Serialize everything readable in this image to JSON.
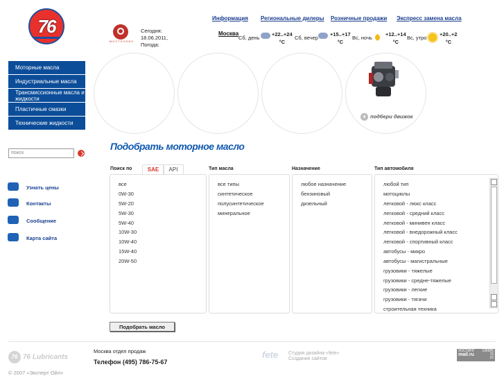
{
  "brand": {
    "logo_text": "76",
    "mos_text": "М О С Т Е Х Н И Ч"
  },
  "top_nav": [
    "Информация",
    "Региональные дилеры",
    "Розничные продажи",
    "Экспресс замена масла"
  ],
  "date": {
    "today_label": "Сегодня:",
    "date": "18.06.2011,",
    "weather_label": "Погода:"
  },
  "weather": {
    "city": "Москва",
    "slots": [
      {
        "label": "Сб, день",
        "temp": "+22..+24",
        "unit": "°C",
        "icon": "cloud-rain-icon"
      },
      {
        "label": "Сб, вечер",
        "temp": "+15..+17",
        "unit": "°C",
        "icon": "cloud-sun-icon"
      },
      {
        "label": "Вс, ночь",
        "temp": "+12..+14",
        "unit": "°C",
        "icon": "moon-icon"
      },
      {
        "label": "Вс, утро",
        "temp": "+20..+22",
        "unit": "°C",
        "icon": "sun-icon"
      }
    ]
  },
  "menu": [
    "Моторные масла",
    "Индустриальные масла",
    "Трансмиссионные масла и жидкости",
    "Пластичные смазки",
    "Технические жидкости"
  ],
  "search": {
    "placeholder": "поиск"
  },
  "side_links": [
    {
      "label": "Узнать цены",
      "icon": "chat-icon"
    },
    {
      "label": "Контакты",
      "icon": "phone-icon"
    },
    {
      "label": "Сообщение",
      "icon": "envelope-icon"
    },
    {
      "label": "Карта сайта",
      "icon": "sitemap-icon"
    }
  ],
  "promo": {
    "label": "подбери движок"
  },
  "selector": {
    "title": "Подобрать моторное масло",
    "search_by": "Поиск по",
    "tabs": [
      "SAE",
      "API"
    ],
    "active_tab": "SAE",
    "headers": [
      "Тип масла",
      "Назначение",
      "Тип автомобиля"
    ],
    "sae": [
      "все",
      "0W-30",
      "5W-20",
      "5W-30",
      "5W-40",
      "10W-30",
      "10W-40",
      "15W-40",
      "20W-50"
    ],
    "oil_types": [
      "все типы",
      "синтетическое",
      "полусинтетическое",
      "минеральное"
    ],
    "purpose": [
      "любое назначение",
      "бензиновый",
      "дизельный"
    ],
    "vehicle_types": [
      "любой тип",
      "мотоциклы",
      "легковой - люкс класс",
      "легковой - средний класс",
      "легковой - минивен класс",
      "легковой - внедорожный класс",
      "легковой - спортивный класс",
      "автобусы - микро",
      "автобусы - магистральные",
      "грузовики - тяжелые",
      "грузовики - средне-тяжелые",
      "грузовики - легкие",
      "грузовики - тягачи",
      "строительная техника"
    ],
    "submit": "Подобрать масло"
  },
  "footer": {
    "brand": "76 Lubricants",
    "copyright": "© 2007 «Эксперт Ойл»",
    "dept": "Москва отдел продаж",
    "phone": "Телефон (495) 786-75-67",
    "studio_logo": "fete",
    "studio_line1": "Студия дизайна «fete»",
    "studio_line2": "Создание сайтов",
    "counter": {
      "label": "ХОСТИНГ",
      "brand": "mail.ru",
      "v1": "136685",
      "v2": "76",
      "v3": "22"
    }
  }
}
